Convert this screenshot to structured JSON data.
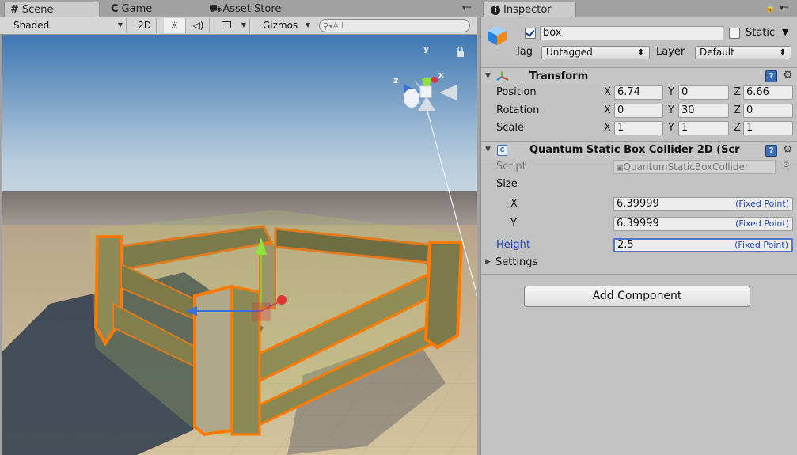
{
  "scene_panel": {
    "tabs": [
      {
        "icon": "#",
        "label": "Scene"
      },
      {
        "icon": "C",
        "label": "Game"
      },
      {
        "icon": "⛟",
        "label": "Asset Store"
      }
    ],
    "toolbar": {
      "draw_mode": "Shaded",
      "btn_2d": "2D",
      "gizmos": "Gizmos",
      "search_placeholder": "All"
    },
    "gizmo_axes": {
      "x": "x",
      "y": "y",
      "z": "z"
    }
  },
  "inspector": {
    "tab_label": "Inspector",
    "object": {
      "enabled": true,
      "name": "box",
      "static_label": "Static",
      "tag_label": "Tag",
      "tag_value": "Untagged",
      "layer_label": "Layer",
      "layer_value": "Default"
    },
    "transform": {
      "title": "Transform",
      "rows": [
        {
          "label": "Position",
          "x": "6.74",
          "y": "0",
          "z": "6.66"
        },
        {
          "label": "Rotation",
          "x": "0",
          "y": "30",
          "z": "0"
        },
        {
          "label": "Scale",
          "x": "1",
          "y": "1",
          "z": "1"
        }
      ],
      "axis_letters": {
        "x": "X",
        "y": "Y",
        "z": "Z"
      }
    },
    "collider": {
      "title": "Quantum Static Box Collider 2D (Scr",
      "script_label": "Script",
      "script_value": "QuantumStaticBoxCollider",
      "size_label": "Size",
      "size_x_label": "X",
      "size_x_value": "6.39999",
      "size_y_label": "Y",
      "size_y_value": "6.39999",
      "height_label": "Height",
      "height_value": "2.5",
      "fixed_point": "(Fixed Point)",
      "settings_label": "Settings"
    },
    "add_component": "Add Component"
  },
  "colors": {
    "sky_top": "#3f78b3",
    "sky_bottom": "#c8d6e0",
    "ground": "#c9b591",
    "selection_outline": "#ff7a00",
    "collider_wire": "#a8e04a",
    "help_blue": "#3d6fb6",
    "fixed_point_text": "#2348b8"
  }
}
